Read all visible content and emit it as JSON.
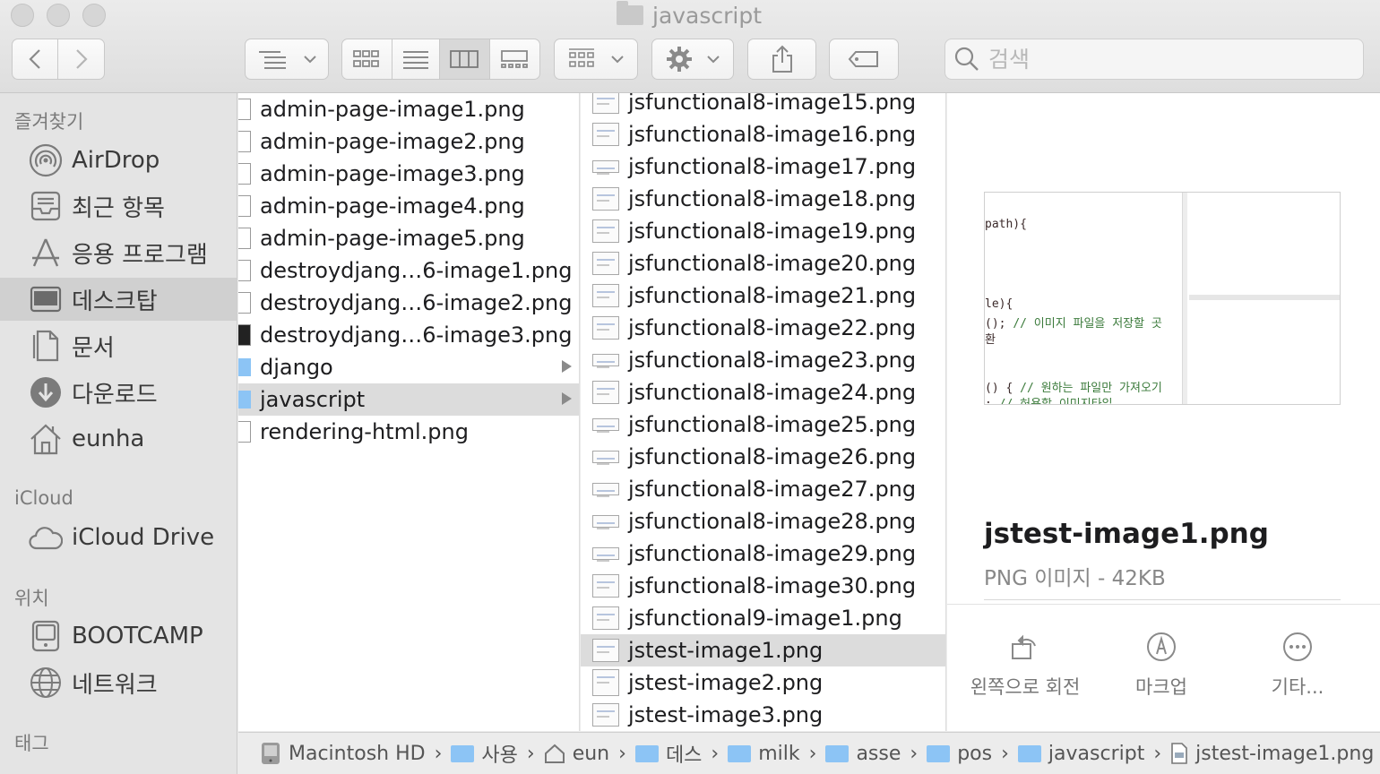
{
  "window": {
    "title": "javascript"
  },
  "search": {
    "placeholder": "검색"
  },
  "sidebar": {
    "sections": [
      {
        "heading": "즐겨찾기"
      },
      {
        "heading": "iCloud"
      },
      {
        "heading": "위치"
      },
      {
        "heading": "태그"
      }
    ],
    "favorites": [
      {
        "label": "AirDrop",
        "icon": "airdrop-icon"
      },
      {
        "label": "최근 항목",
        "icon": "recents-icon"
      },
      {
        "label": "응용 프로그램",
        "icon": "applications-icon"
      },
      {
        "label": "데스크탑",
        "icon": "desktop-icon",
        "selected": true
      },
      {
        "label": "문서",
        "icon": "documents-icon"
      },
      {
        "label": "다운로드",
        "icon": "downloads-icon"
      },
      {
        "label": "eunha",
        "icon": "home-icon"
      }
    ],
    "icloud": [
      {
        "label": "iCloud Drive",
        "icon": "cloud-icon"
      }
    ],
    "locations": [
      {
        "label": "BOOTCAMP",
        "icon": "disk-icon"
      },
      {
        "label": "네트워크",
        "icon": "network-icon"
      }
    ]
  },
  "column1": {
    "items": [
      {
        "name": "admin-page-image1.png",
        "kind": "file"
      },
      {
        "name": "admin-page-image2.png",
        "kind": "file"
      },
      {
        "name": "admin-page-image3.png",
        "kind": "file"
      },
      {
        "name": "admin-page-image4.png",
        "kind": "file"
      },
      {
        "name": "admin-page-image5.png",
        "kind": "file"
      },
      {
        "name": "destroydjang…6-image1.png",
        "kind": "file"
      },
      {
        "name": "destroydjang…6-image2.png",
        "kind": "file"
      },
      {
        "name": "destroydjang…6-image3.png",
        "kind": "file-dark"
      },
      {
        "name": "django",
        "kind": "folder"
      },
      {
        "name": "javascript",
        "kind": "folder",
        "selected": true
      },
      {
        "name": "rendering-html.png",
        "kind": "file"
      }
    ]
  },
  "column2": {
    "items": [
      "jsfunctional8-image15.png",
      "jsfunctional8-image16.png",
      "jsfunctional8-image17.png",
      "jsfunctional8-image18.png",
      "jsfunctional8-image19.png",
      "jsfunctional8-image20.png",
      "jsfunctional8-image21.png",
      "jsfunctional8-image22.png",
      "jsfunctional8-image23.png",
      "jsfunctional8-image24.png",
      "jsfunctional8-image25.png",
      "jsfunctional8-image26.png",
      "jsfunctional8-image27.png",
      "jsfunctional8-image28.png",
      "jsfunctional8-image29.png",
      "jsfunctional8-image30.png",
      "jsfunctional9-image1.png",
      "jstest-image1.png",
      "jstest-image2.png",
      "jstest-image3.png"
    ],
    "selected": "jstest-image1.png"
  },
  "preview": {
    "filename": "jstest-image1.png",
    "meta": "PNG 이미지 - 42KB",
    "code_lines": [
      {
        "text": "path){",
        "comment": ""
      },
      {
        "text": "le){",
        "comment": ""
      },
      {
        "text": "(); ",
        "comment": "// 이미지 파일을 저장할 곳"
      },
      {
        "text": "환",
        "comment": ""
      },
      {
        "text": "() { ",
        "comment": "// 원하는 파일만 가져오기"
      },
      {
        "text": ": ",
        "comment": "// 허용할 이미지타입"
      }
    ],
    "actions": [
      {
        "label": "왼쪽으로 회전",
        "icon": "rotate-left-icon"
      },
      {
        "label": "마크업",
        "icon": "markup-icon"
      },
      {
        "label": "기타...",
        "icon": "more-icon"
      }
    ]
  },
  "pathbar": {
    "crumbs": [
      {
        "label": "Macintosh HD",
        "icon": "hard-drive-icon"
      },
      {
        "label": "사용",
        "icon": "users-folder-icon"
      },
      {
        "label": "eun",
        "icon": "home-icon"
      },
      {
        "label": "데스",
        "icon": "desktop-folder-icon"
      },
      {
        "label": "milk",
        "icon": "folder-icon"
      },
      {
        "label": "asse",
        "icon": "folder-icon"
      },
      {
        "label": "pos",
        "icon": "folder-icon"
      },
      {
        "label": "javascript",
        "icon": "folder-icon"
      },
      {
        "label": "jstest-image1.png",
        "icon": "image-file-icon"
      }
    ]
  },
  "colors": {
    "folder": "#8cc4f5",
    "selection": "#dcdcdc",
    "sidebar_bg": "#e4e4e4"
  }
}
